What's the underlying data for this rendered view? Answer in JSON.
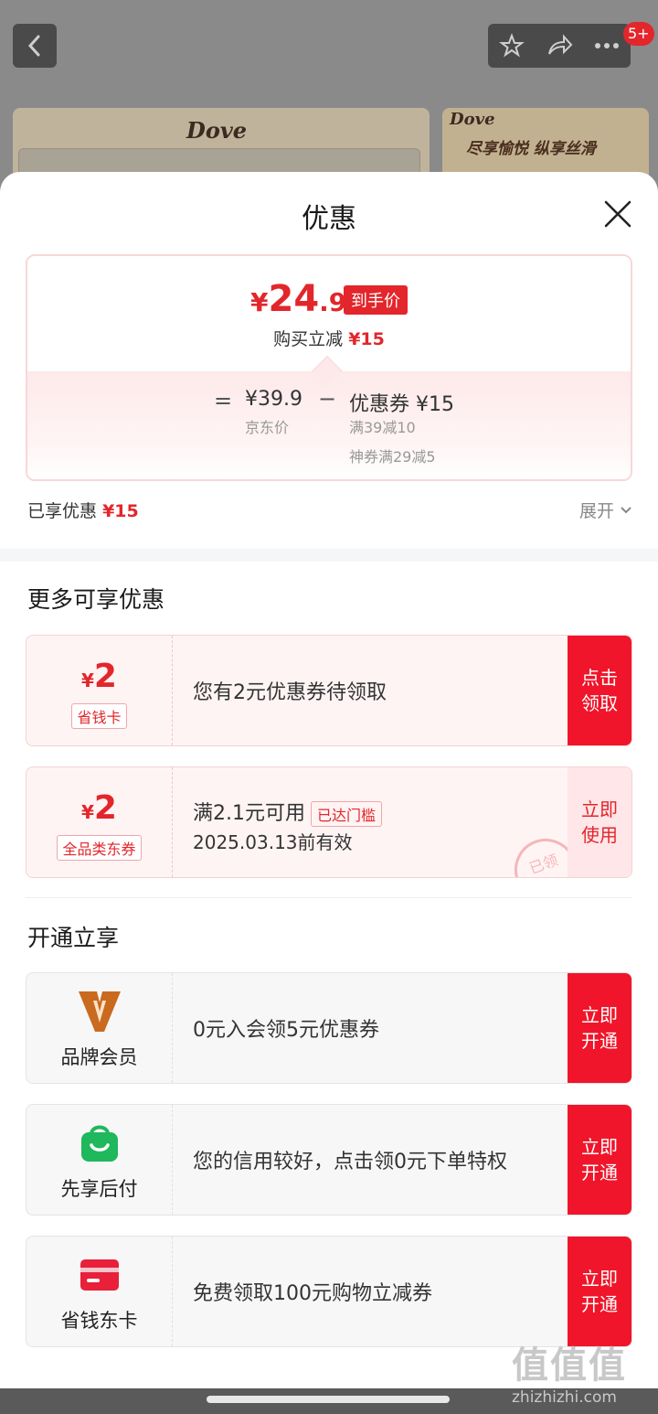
{
  "background": {
    "notification_count": "5+",
    "brand_logo": "Dove",
    "slogan": "尽享愉悦 纵享丝滑"
  },
  "sheet": {
    "title": "优惠",
    "price": {
      "currency": "¥",
      "integer": "24",
      "decimal": ".9",
      "tag": "到手价",
      "buy_less_label": "购买立减",
      "buy_less_value": "¥15",
      "equals": "=",
      "jd_price": "¥39.9",
      "jd_label": "京东价",
      "minus": "−",
      "coupon_label": "优惠券 ¥15",
      "coupon_detail_1": "满39减10",
      "coupon_detail_2": "神券满29减5"
    },
    "enjoyed_label": "已享优惠",
    "enjoyed_value": "¥15",
    "expand_label": "展开"
  },
  "more_offers": {
    "title": "更多可享优惠",
    "items": [
      {
        "currency": "¥",
        "amount": "2",
        "tag": "省钱卡",
        "desc": "您有2元优惠券待领取",
        "action": "点击领取"
      },
      {
        "currency": "¥",
        "amount": "2",
        "tag": "全品类东券",
        "desc": "满2.1元可用",
        "badge": "已达门槛",
        "validity": "2025.03.13前有效",
        "action": "立即使用",
        "stamp": "已领"
      }
    ]
  },
  "open_section": {
    "title": "开通立享",
    "items": [
      {
        "icon": "brand-member-icon",
        "label": "品牌会员",
        "desc": "0元入会领5元优惠券",
        "action": "立即开通"
      },
      {
        "icon": "shopping-bag-icon",
        "label": "先享后付",
        "desc": "您的信用较好，点击领0元下单特权",
        "action": "立即开通"
      },
      {
        "icon": "card-icon",
        "label": "省钱东卡",
        "desc": "免费领取100元购物立减券",
        "action": "立即开通"
      }
    ]
  },
  "watermark": {
    "logo": "值值值",
    "url": "zhizhizhi.com"
  },
  "colors": {
    "accent": "#e3262b",
    "action_red": "#f0152a"
  }
}
